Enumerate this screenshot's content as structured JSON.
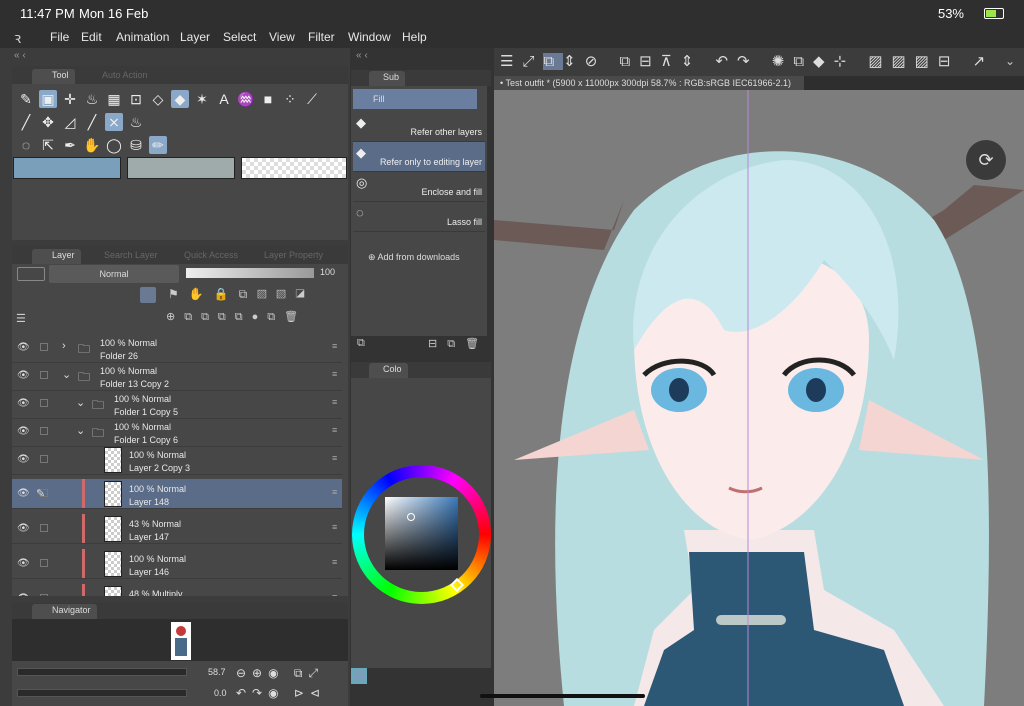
{
  "status": {
    "time": "11:47 PM",
    "date": "Mon 16 Feb",
    "battery": "53%"
  },
  "menu": {
    "items": [
      "File",
      "Edit",
      "Animation",
      "Layer",
      "Select",
      "View",
      "Filter",
      "Window",
      "Help"
    ]
  },
  "tool_panel": {
    "tab": "Tool",
    "tab2": "Auto Action"
  },
  "layer_panel": {
    "tabs": [
      "Layer",
      "Search Layer",
      "Quick Access",
      "Layer Property"
    ],
    "blend_mode": "Normal",
    "opacity": "100",
    "layers": [
      {
        "line1": "100 % Normal",
        "line2": "Folder 26"
      },
      {
        "line1": "100 % Normal",
        "line2": "Folder 13 Copy 2"
      },
      {
        "line1": "100 % Normal",
        "line2": "Folder 1 Copy 5"
      },
      {
        "line1": "100 % Normal",
        "line2": "Folder 1 Copy 6"
      },
      {
        "line1": "100 % Normal",
        "line2": "Layer 2 Copy 3"
      },
      {
        "line1": "100 % Normal",
        "line2": "Layer 148"
      },
      {
        "line1": "43 % Normal",
        "line2": "Layer 147"
      },
      {
        "line1": "100 % Normal",
        "line2": "Layer 146"
      },
      {
        "line1": "48 % Multiply",
        "line2": ""
      }
    ]
  },
  "sub_tool": {
    "tab": "Sub",
    "header": "Fill",
    "items": [
      "Refer other layers",
      "Refer only to editing layer",
      "Enclose and fill",
      "Lasso fill"
    ],
    "add": "Add from downloads"
  },
  "color_panel": {
    "tab": "Colo"
  },
  "navigator": {
    "tab": "Navigator",
    "zoom": "58.7",
    "rotation": "0.0"
  },
  "canvas": {
    "title": "Test outfit * (5900 x 11000px 300dpi 58.7% : RGB:sRGB IEC61966-2.1)"
  }
}
